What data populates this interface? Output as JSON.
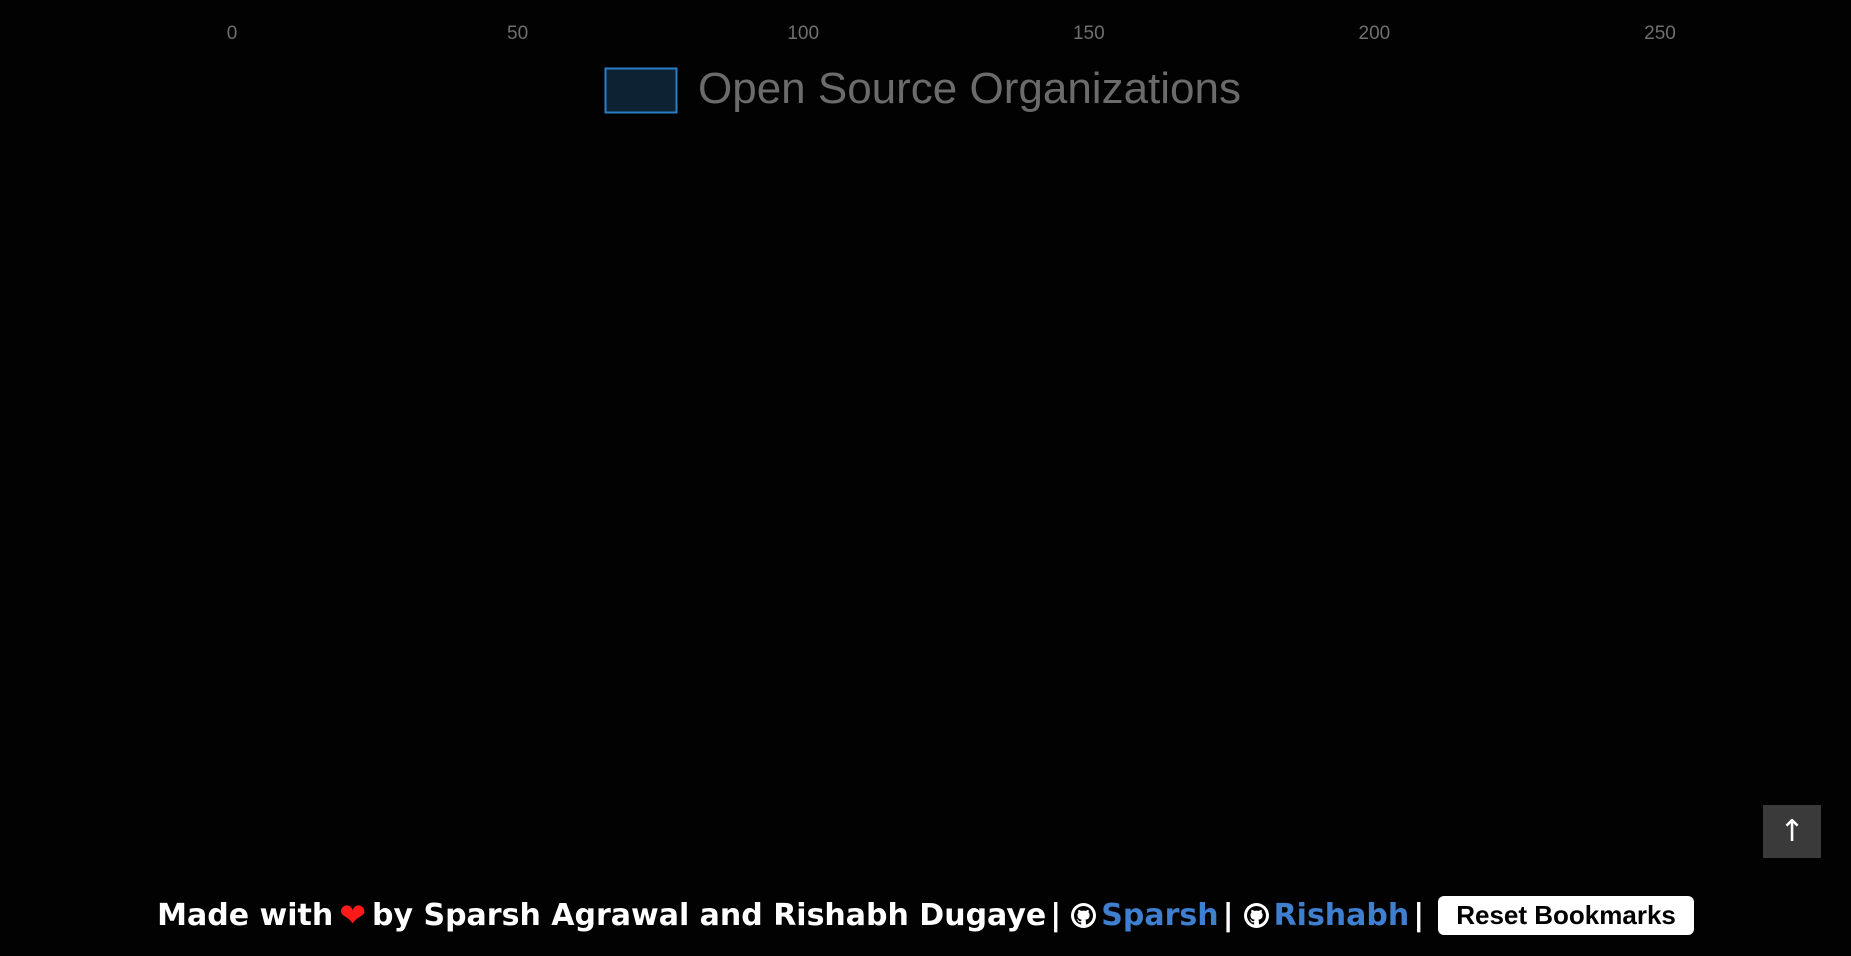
{
  "chart_data": {
    "type": "bar",
    "orientation": "horizontal",
    "xlim": [
      0,
      270
    ],
    "ticks": [
      0,
      50,
      100,
      150,
      200,
      250
    ],
    "legend": {
      "position": "top",
      "label": "Open Source Organizations"
    },
    "series": [
      {
        "name": "Open Source Organizations",
        "values": [],
        "fill": "#0d2233",
        "stroke": "#2a7fc4"
      }
    ],
    "categories": [],
    "grid": false
  },
  "scroll_top": {
    "label": "↑"
  },
  "footer": {
    "made_with": "Made with",
    "heart": "❤",
    "by_text": "by Sparsh Agrawal and Rishabh Dugaye",
    "sep": "|",
    "link1": "Sparsh",
    "link2": "Rishabh",
    "reset_button": "Reset Bookmarks"
  },
  "colors": {
    "background": "#020202",
    "link": "#3f7fcf",
    "heart": "#ff1a1a"
  }
}
